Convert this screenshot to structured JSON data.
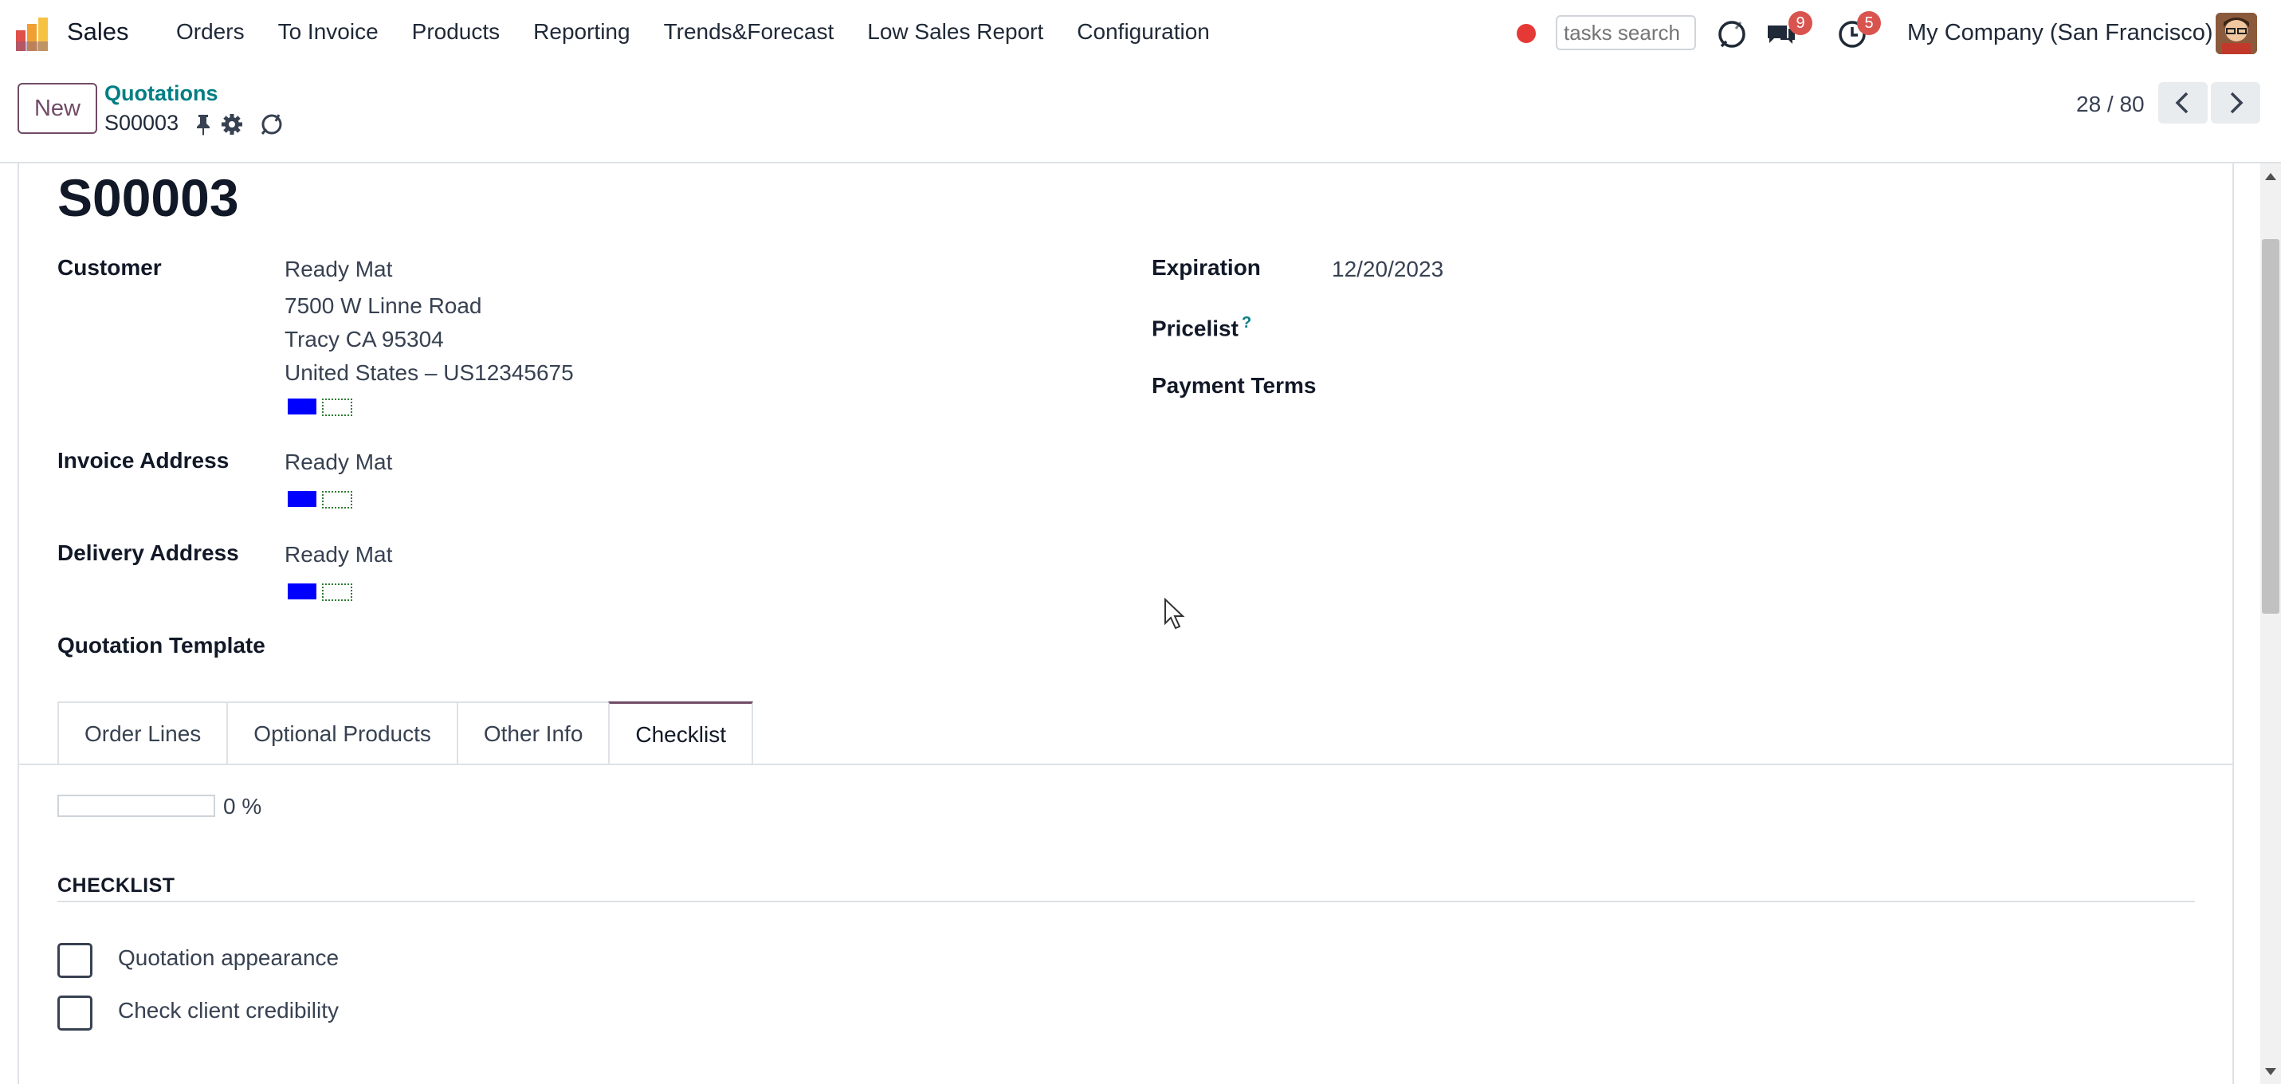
{
  "navbar": {
    "app_name": "Sales",
    "menu": [
      "Orders",
      "To Invoice",
      "Products",
      "Reporting",
      "Trends&Forecast",
      "Low Sales Report",
      "Configuration"
    ],
    "search_placeholder": "tasks search",
    "messages_badge": "9",
    "activities_badge": "5",
    "company": "My Company (San Francisco)",
    "icons": [
      "recording-dot",
      "chat-icon",
      "messages-icon",
      "activity-clock-icon",
      "avatar"
    ]
  },
  "control_panel": {
    "new_label": "New",
    "breadcrumb_parent": "Quotations",
    "breadcrumb_current": "S00003",
    "pager": "28 / 80"
  },
  "form": {
    "title": "S00003",
    "customer_label": "Customer",
    "customer_name": "Ready Mat",
    "customer_address": [
      "7500 W Linne Road",
      "Tracy CA 95304",
      "United States – US12345675"
    ],
    "invoice_address_label": "Invoice Address",
    "invoice_address_value": "Ready Mat",
    "delivery_address_label": "Delivery Address",
    "delivery_address_value": "Ready Mat",
    "quotation_template_label": "Quotation Template",
    "expiration_label": "Expiration",
    "expiration_value": "12/20/2023",
    "pricelist_label": "Pricelist",
    "pricelist_help": "?",
    "payment_terms_label": "Payment Terms"
  },
  "tabs": [
    {
      "label": "Order Lines",
      "active": false
    },
    {
      "label": "Optional Products",
      "active": false
    },
    {
      "label": "Other Info",
      "active": false
    },
    {
      "label": "Checklist",
      "active": true
    }
  ],
  "checklist": {
    "progress_percent": 0,
    "progress_text": "0 %",
    "section_title": "CHECKLIST",
    "items": [
      {
        "label": "Quotation appearance",
        "checked": false
      },
      {
        "label": "Check client credibility",
        "checked": false
      }
    ]
  },
  "colors": {
    "brand": "#714b67",
    "link": "#017e84",
    "badge": "#d9534f"
  }
}
